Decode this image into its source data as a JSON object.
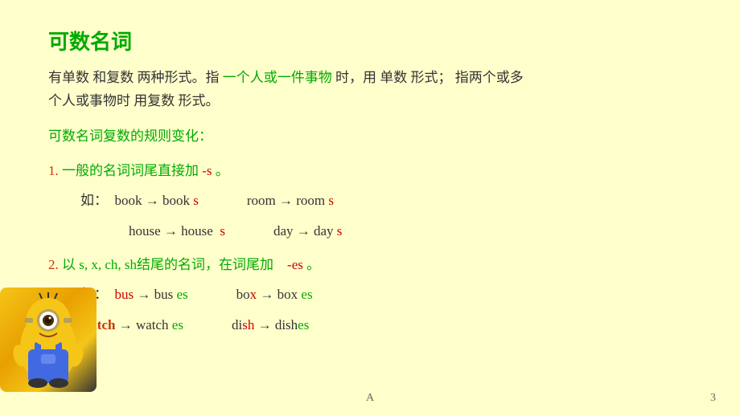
{
  "slide": {
    "title": "可数名词",
    "intro_line1_parts": [
      {
        "text": "有单数 和复数 两种形式。指 ",
        "color": "normal"
      },
      {
        "text": "一个人或一件事物",
        "color": "green"
      },
      {
        "text": " 时，用 单数 形式；  指两个或多",
        "color": "normal"
      }
    ],
    "intro_line2_parts": [
      {
        "text": "个人或事物时  用复数 形式。",
        "color": "normal"
      }
    ],
    "subtitle": "可数名词复数的规则变化：",
    "rule1_title": "1.  一般的名词词尾直接加 -s 。",
    "rule1_examples": {
      "label": "如：",
      "row1": [
        {
          "base": "book",
          "arrow": "→",
          "plural_base": "book",
          "plural_s": "s"
        },
        {
          "base": "room",
          "arrow": "→",
          "plural_base": "room",
          "plural_s": "s"
        }
      ],
      "row2": [
        {
          "base": "house",
          "arrow": "→",
          "plural_base": "house",
          "plural_s": "s"
        },
        {
          "base": "day",
          "arrow": "→",
          "plural_base": "day",
          "plural_s": "s"
        }
      ]
    },
    "rule2_title": "2.  以 s, x, ch, sh结尾的名词，在词尾加    -es 。",
    "rule2_examples": {
      "label": "如：",
      "row1": [
        {
          "base": "bus",
          "arrow": "→",
          "plural_base": "bus",
          "plural_s": "es"
        },
        {
          "base": "bo",
          "special": "x",
          "arrow": "→",
          "plural_base": "box",
          "plural_s": "es"
        }
      ],
      "row2": [
        {
          "base_highlight": "watch",
          "base_rest": " → watch",
          "plural_s": "es"
        },
        {
          "base": "di",
          "special": "sh",
          "arrow": "→",
          "plural_base": "dish",
          "plural_s": "es"
        }
      ]
    },
    "footer_center": "A",
    "footer_page": "3"
  }
}
